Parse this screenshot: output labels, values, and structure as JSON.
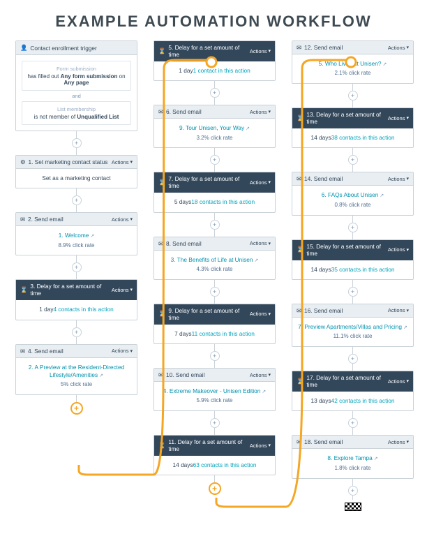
{
  "page_title": "EXAMPLE AUTOMATION WORKFLOW",
  "labels": {
    "actions": "Actions",
    "and": "and"
  },
  "trigger": {
    "header": "Contact enrollment trigger",
    "form_label": "Form submission",
    "form_text1": "has filled out",
    "form_bold1": "Any form submission",
    "form_text2": "on",
    "form_bold2": "Any page",
    "list_label": "List membership",
    "list_text": "is not member of",
    "list_bold": "Unqualified List"
  },
  "col1": [
    {
      "kind": "step",
      "dark": false,
      "num": "1.",
      "title": "Set marketing contact status",
      "body": "Set as a marketing contact"
    },
    {
      "kind": "email",
      "dark": false,
      "num": "2.",
      "title": "Send email",
      "link_num": "1.",
      "link": "Welcome",
      "rate": "8.9% click rate"
    },
    {
      "kind": "delay",
      "dark": true,
      "num": "3.",
      "title": "Delay for a set amount of time",
      "delay": "1 day",
      "contacts": "4 contacts in this action"
    },
    {
      "kind": "email",
      "dark": false,
      "num": "4.",
      "title": "Send email",
      "link_num": "2.",
      "link": "A Preview at the Resident-Directed Lifestyle/Amenities",
      "rate": "5% click rate"
    }
  ],
  "col2": [
    {
      "kind": "delay",
      "dark": true,
      "num": "5.",
      "title": "Delay for a set amount of time",
      "delay": "1 day",
      "contacts": "1 contact in this action"
    },
    {
      "kind": "email",
      "dark": false,
      "num": "6.",
      "title": "Send email",
      "link_num": "9.",
      "link": "Tour Unisen, Your Way",
      "rate": "3.2% click rate"
    },
    {
      "kind": "delay",
      "dark": true,
      "num": "7.",
      "title": "Delay for a set amount of time",
      "delay": "5 days",
      "contacts": "18 contacts in this action"
    },
    {
      "kind": "email",
      "dark": false,
      "num": "8.",
      "title": "Send email",
      "link_num": "3.",
      "link": "The Benefits of Life at Unisen",
      "rate": "4.3% click rate"
    },
    {
      "kind": "delay",
      "dark": true,
      "num": "9.",
      "title": "Delay for a set amount of time",
      "delay": "7 days",
      "contacts": "11 contacts in this action"
    },
    {
      "kind": "email",
      "dark": false,
      "num": "10.",
      "title": "Send email",
      "link_num": "4.",
      "link": "Extreme Makeover - Unisen Edition",
      "rate": "5.9% click rate"
    },
    {
      "kind": "delay",
      "dark": true,
      "num": "11.",
      "title": "Delay for a set amount of time",
      "delay": "14 days",
      "contacts": "63 contacts in this action"
    }
  ],
  "col3": [
    {
      "kind": "email",
      "dark": false,
      "num": "12.",
      "title": "Send email",
      "link_num": "5.",
      "link": "Who Lives at Unisen?",
      "rate": "2.1% click rate"
    },
    {
      "kind": "delay",
      "dark": true,
      "num": "13.",
      "title": "Delay for a set amount of time",
      "delay": "14 days",
      "contacts": "38 contacts in this action"
    },
    {
      "kind": "email",
      "dark": false,
      "num": "14.",
      "title": "Send email",
      "link_num": "6.",
      "link": "FAQs About Unisen",
      "rate": "0.8% click rate"
    },
    {
      "kind": "delay",
      "dark": true,
      "num": "15.",
      "title": "Delay for a set amount of time",
      "delay": "14 days",
      "contacts": "35 contacts in this action"
    },
    {
      "kind": "email",
      "dark": false,
      "num": "16.",
      "title": "Send email",
      "link_num": "7.",
      "link": "Preview Apartments/Villas and Pricing",
      "rate": "11.1% click rate"
    },
    {
      "kind": "delay",
      "dark": true,
      "num": "17.",
      "title": "Delay for a set amount of time",
      "delay": "13 days",
      "contacts": "42 contacts in this action"
    },
    {
      "kind": "email",
      "dark": false,
      "num": "18.",
      "title": "Send email",
      "link_num": "8.",
      "link": "Explore Tampa",
      "rate": "1.8% click rate"
    }
  ]
}
